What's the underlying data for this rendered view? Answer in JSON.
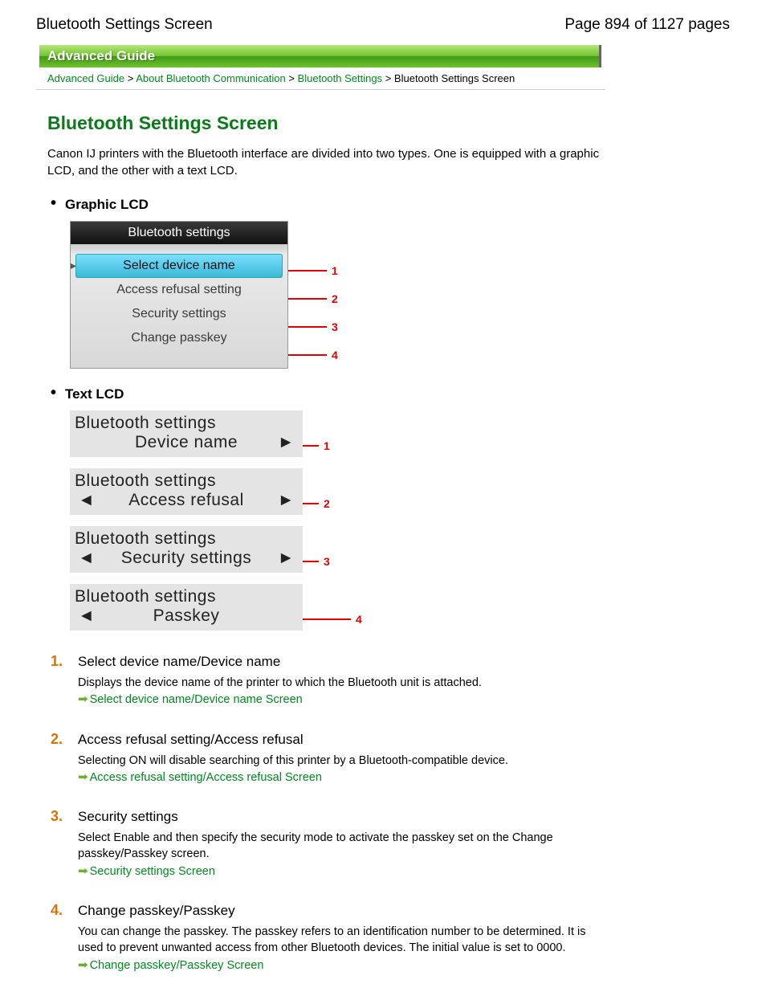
{
  "header": {
    "title_left": "Bluetooth Settings Screen",
    "page_indicator": "Page 894 of 1127 pages"
  },
  "banner": "Advanced Guide",
  "breadcrumb": {
    "items": [
      "Advanced Guide",
      "About Bluetooth Communication",
      "Bluetooth Settings"
    ],
    "current": "Bluetooth Settings Screen",
    "sep": ">"
  },
  "page_title": "Bluetooth Settings Screen",
  "intro": "Canon IJ printers with the Bluetooth interface are divided into two types. One is equipped with a graphic LCD, and the other with a text LCD.",
  "sections": {
    "graphic_lcd": {
      "heading": "Graphic LCD",
      "panel_title": "Bluetooth settings",
      "items": [
        "Select device name",
        "Access refusal setting",
        "Security settings",
        "Change passkey"
      ],
      "callouts": [
        "1",
        "2",
        "3",
        "4"
      ]
    },
    "text_lcd": {
      "heading": "Text LCD",
      "panels": [
        {
          "line1": "Bluetooth settings",
          "line2": "Device name",
          "left": false,
          "right": true,
          "num": "1"
        },
        {
          "line1": "Bluetooth settings",
          "line2": "Access refusal",
          "left": true,
          "right": true,
          "num": "2"
        },
        {
          "line1": "Bluetooth settings",
          "line2": "Security settings",
          "left": true,
          "right": true,
          "num": "3"
        },
        {
          "line1": "Bluetooth settings",
          "line2": "Passkey",
          "left": true,
          "right": false,
          "num": "4"
        }
      ]
    }
  },
  "numbered": [
    {
      "num": "1.",
      "title": "Select device name/Device name",
      "body": "Displays the device name of the printer to which the Bluetooth unit is attached.",
      "link": "Select device name/Device name Screen"
    },
    {
      "num": "2.",
      "title": "Access refusal setting/Access refusal",
      "body": "Selecting ON will disable searching of this printer by a Bluetooth-compatible device.",
      "link": "Access refusal setting/Access refusal Screen"
    },
    {
      "num": "3.",
      "title": "Security settings",
      "body": "Select Enable and then specify the security mode to activate the passkey set on the Change passkey/Passkey screen.",
      "link": "Security settings Screen"
    },
    {
      "num": "4.",
      "title": "Change passkey/Passkey",
      "body": "You can change the passkey. The passkey refers to an identification number to be determined. It is used to prevent unwanted access from other Bluetooth devices. The initial value is set to 0000.",
      "link": "Change passkey/Passkey Screen"
    }
  ]
}
